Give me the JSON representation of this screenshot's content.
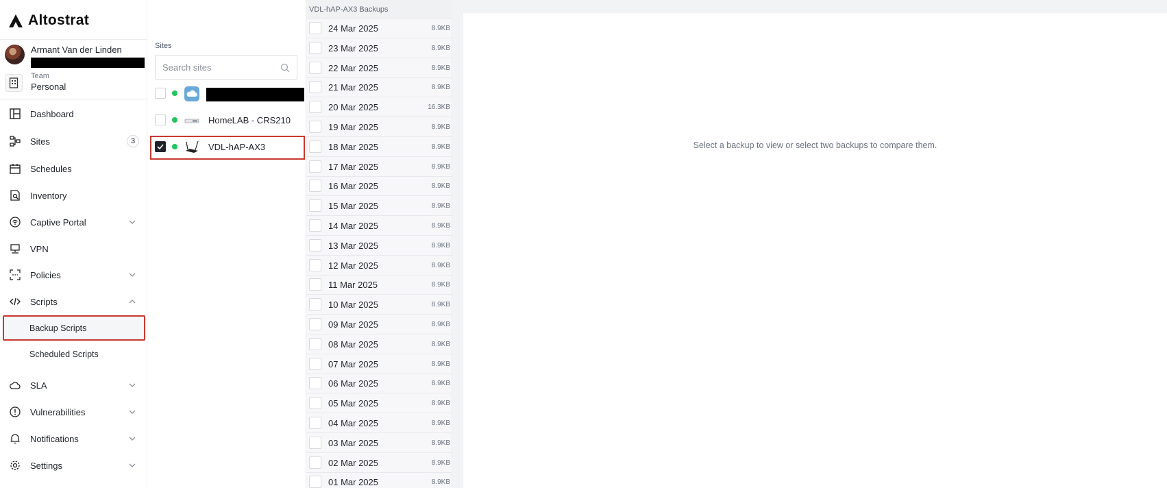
{
  "app": {
    "brand": "Altostrat"
  },
  "user": {
    "name": "Armant Van der Linden"
  },
  "team": {
    "label": "Team",
    "name": "Personal"
  },
  "nav": {
    "dashboard": "Dashboard",
    "sites": "Sites",
    "sites_count": "3",
    "schedules": "Schedules",
    "inventory": "Inventory",
    "captive_portal": "Captive Portal",
    "vpn": "VPN",
    "policies": "Policies",
    "scripts": "Scripts",
    "backup_scripts": "Backup Scripts",
    "scheduled_scripts": "Scheduled Scripts",
    "sla": "SLA",
    "vulnerabilities": "Vulnerabilities",
    "notifications": "Notifications",
    "settings": "Settings"
  },
  "sites_panel": {
    "label": "Sites",
    "search_placeholder": "Search sites",
    "sites": [
      {
        "name": "",
        "online": true,
        "checked": false
      },
      {
        "name": "HomeLAB - CRS210",
        "online": true,
        "checked": false
      },
      {
        "name": "VDL-hAP-AX3",
        "online": true,
        "checked": true
      }
    ]
  },
  "backups_panel": {
    "title": "VDL-hAP-AX3 Backups",
    "items": [
      {
        "date": "24 Mar 2025",
        "size": "8.9KB"
      },
      {
        "date": "23 Mar 2025",
        "size": "8.9KB"
      },
      {
        "date": "22 Mar 2025",
        "size": "8.9KB"
      },
      {
        "date": "21 Mar 2025",
        "size": "8.9KB"
      },
      {
        "date": "20 Mar 2025",
        "size": "16.3KB"
      },
      {
        "date": "19 Mar 2025",
        "size": "8.9KB"
      },
      {
        "date": "18 Mar 2025",
        "size": "8.9KB"
      },
      {
        "date": "17 Mar 2025",
        "size": "8.9KB"
      },
      {
        "date": "16 Mar 2025",
        "size": "8.9KB"
      },
      {
        "date": "15 Mar 2025",
        "size": "8.9KB"
      },
      {
        "date": "14 Mar 2025",
        "size": "8.9KB"
      },
      {
        "date": "13 Mar 2025",
        "size": "8.9KB"
      },
      {
        "date": "12 Mar 2025",
        "size": "8.9KB"
      },
      {
        "date": "11 Mar 2025",
        "size": "8.9KB"
      },
      {
        "date": "10 Mar 2025",
        "size": "8.9KB"
      },
      {
        "date": "09 Mar 2025",
        "size": "8.9KB"
      },
      {
        "date": "08 Mar 2025",
        "size": "8.9KB"
      },
      {
        "date": "07 Mar 2025",
        "size": "8.9KB"
      },
      {
        "date": "06 Mar 2025",
        "size": "8.9KB"
      },
      {
        "date": "05 Mar 2025",
        "size": "8.9KB"
      },
      {
        "date": "04 Mar 2025",
        "size": "8.9KB"
      },
      {
        "date": "03 Mar 2025",
        "size": "8.9KB"
      },
      {
        "date": "02 Mar 2025",
        "size": "8.9KB"
      },
      {
        "date": "01 Mar 2025",
        "size": "8.9KB"
      }
    ]
  },
  "main": {
    "empty_message": "Select a backup to view or select two backups to compare them."
  },
  "colors": {
    "accent_highlight": "#c8392e",
    "online": "#22c55e"
  }
}
